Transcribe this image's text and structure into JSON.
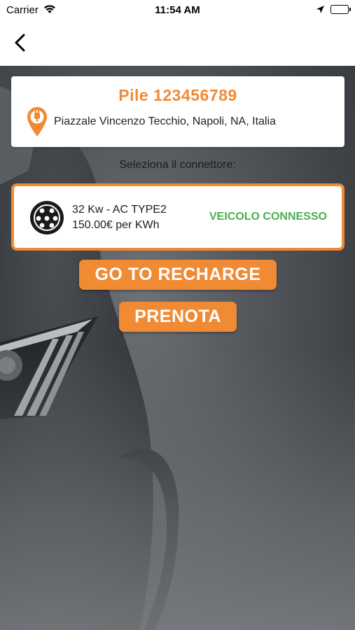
{
  "status_bar": {
    "carrier": "Carrier",
    "time": "11:54 AM",
    "battery_level": 1.0
  },
  "nav": {
    "back_icon": "chevron-left-icon"
  },
  "pile": {
    "title": "Pile 123456789",
    "address": "Piazzale Vincenzo Tecchio, Napoli, NA, Italia",
    "icon": "charging-pin-icon"
  },
  "select_label": "Seleziona il connettore:",
  "connector": {
    "icon": "type2-socket-icon",
    "power": "32 Kw - AC TYPE2",
    "price": "150.00€ per KWh",
    "status": "VEICOLO CONNESSO"
  },
  "buttons": {
    "recharge": "GO TO RECHARGE",
    "prenota": "PRENOTA"
  },
  "colors": {
    "accent": "#f08a33",
    "status_ok": "#4caf50"
  }
}
